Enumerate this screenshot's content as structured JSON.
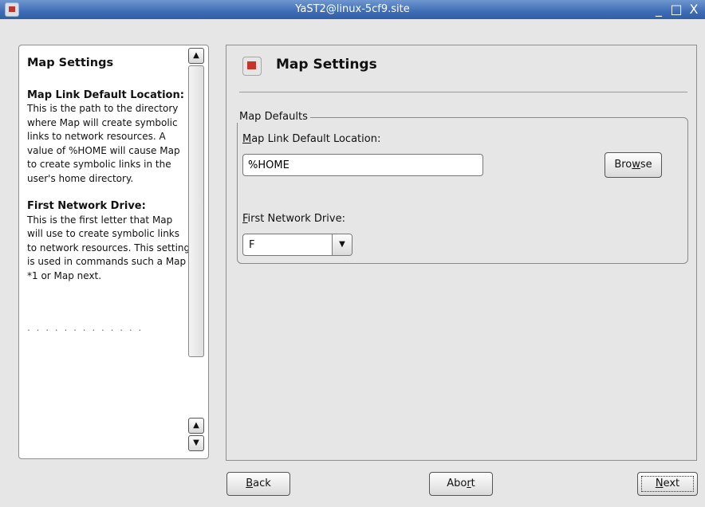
{
  "window": {
    "title": "YaST2@linux-5cf9.site",
    "controls": [
      "_",
      "□",
      "X"
    ]
  },
  "help": {
    "title": "Map Settings",
    "sections": [
      {
        "heading": "Map Link Default Location:",
        "body": "This is the path to the directory where Map will create symbolic links to network resources. A value of %HOME will cause Map to create symbolic links in the user's home directory."
      },
      {
        "heading": "First Network Drive:",
        "body": "This is the first letter that Map will use to create symbolic links to network resources. This setting is used in commands such a Map *1 or Map next."
      }
    ],
    "faded_text": ". .  .  . .  .  .  .  .  .  . .  ."
  },
  "main": {
    "title": "Map Settings",
    "group_label": "Map Defaults",
    "link_location_label_prefix": "",
    "link_location_label_mnemonic": "M",
    "link_location_label_rest": "ap Link Default Location:",
    "link_location_value": "%HOME",
    "browse_label_a": "Bro",
    "browse_label_u": "w",
    "browse_label_b": "se",
    "first_drive_label_mnemonic": "F",
    "first_drive_label_rest": "irst Network Drive:",
    "first_drive_value": "F"
  },
  "footer": {
    "back_u": "B",
    "back_rest": "ack",
    "abort_a": "Abo",
    "abort_u": "r",
    "abort_b": "t",
    "next_u": "N",
    "next_rest": "ext"
  },
  "icons": {
    "scroll_up": "▲",
    "scroll_down": "▼",
    "combo_arrow": "▼"
  }
}
